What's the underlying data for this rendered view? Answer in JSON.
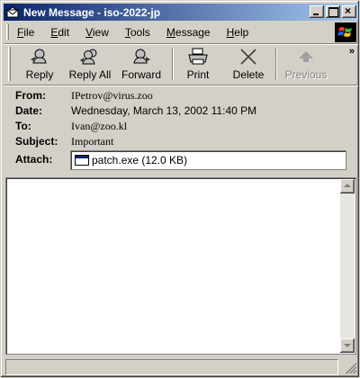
{
  "window": {
    "title": "New Message - iso-2022-jp",
    "icon": "envelope-icon",
    "controls": [
      "minimize-icon",
      "maximize-icon",
      "close-icon"
    ],
    "close_glyph": "×"
  },
  "menu": {
    "items": [
      {
        "label": "File",
        "underline": "F",
        "rest": "ile"
      },
      {
        "label": "Edit",
        "underline": "E",
        "rest": "dit"
      },
      {
        "label": "View",
        "underline": "V",
        "rest": "iew"
      },
      {
        "label": "Tools",
        "underline": "T",
        "rest": "ools"
      },
      {
        "label": "Message",
        "underline": "M",
        "rest": "essage"
      },
      {
        "label": "Help",
        "underline": "H",
        "rest": "elp"
      }
    ],
    "logo": "windows-flag-icon"
  },
  "toolbar": {
    "buttons": [
      {
        "label": "Reply",
        "icon": "reply-icon",
        "enabled": true
      },
      {
        "label": "Reply All",
        "icon": "reply-all-icon",
        "enabled": true
      },
      {
        "label": "Forward",
        "icon": "forward-icon",
        "enabled": true
      },
      {
        "label": "Print",
        "icon": "printer-icon",
        "enabled": true
      },
      {
        "label": "Delete",
        "icon": "delete-x-icon",
        "enabled": true
      },
      {
        "label": "Previous",
        "icon": "up-arrow-icon",
        "enabled": false
      }
    ],
    "overflow": "»"
  },
  "header": {
    "from_label": "From:",
    "from_value": "IPetrov@virus.zoo",
    "date_label": "Date:",
    "date_value": "Wednesday, March 13, 2002 11:40 PM",
    "to_label": "To:",
    "to_value": "Ivan@zoo.kl",
    "subject_label": "Subject:",
    "subject_value": "Important",
    "attach_label": "Attach:",
    "attachment": {
      "name": "patch.exe (12.0 KB)",
      "icon": "executable-file-icon"
    }
  },
  "message_body": {
    "text": ""
  },
  "colors": {
    "titlebar_start": "#0a246a",
    "titlebar_end": "#a6caf0",
    "face": "#d4d0c8"
  }
}
